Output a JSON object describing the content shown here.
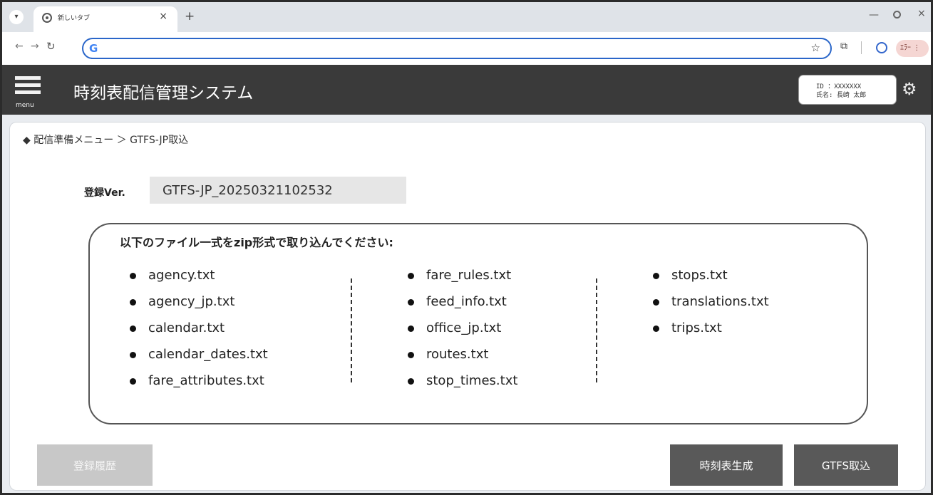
{
  "browser": {
    "tab_title": "新しいタブ",
    "new_tab_label": "+",
    "address": "",
    "error_chip_label": "ｴﾗｰ"
  },
  "app": {
    "menu_label": "menu",
    "title": "時刻表配信管理システム",
    "user": {
      "id_line": "ID ：XXXXXXX",
      "name_line": "氏名: 長崎 太郎"
    }
  },
  "breadcrumb": "◆ 配信準備メニュー ＞ GTFS-JP取込",
  "registration": {
    "label": "登録Ver.",
    "value": "GTFS-JP_20250321102532"
  },
  "instructions": {
    "text": "以下のファイル一式をzip形式で取り込んでください:",
    "files": [
      [
        "agency.txt",
        "agency_jp.txt",
        "calendar.txt",
        "calendar_dates.txt",
        "fare_attributes.txt"
      ],
      [
        "fare_rules.txt",
        "feed_info.txt",
        "office_jp.txt",
        "routes.txt",
        "stop_times.txt"
      ],
      [
        "stops.txt",
        "translations.txt",
        "trips.txt"
      ]
    ]
  },
  "buttons": {
    "history": "登録履歴",
    "generate": "時刻表生成",
    "import": "GTFS取込"
  },
  "colors": {
    "header_bg": "#3a3a3a",
    "button_active": "#595959",
    "button_disabled": "#c8c8c8",
    "omnibox_border": "#2a66c9"
  }
}
